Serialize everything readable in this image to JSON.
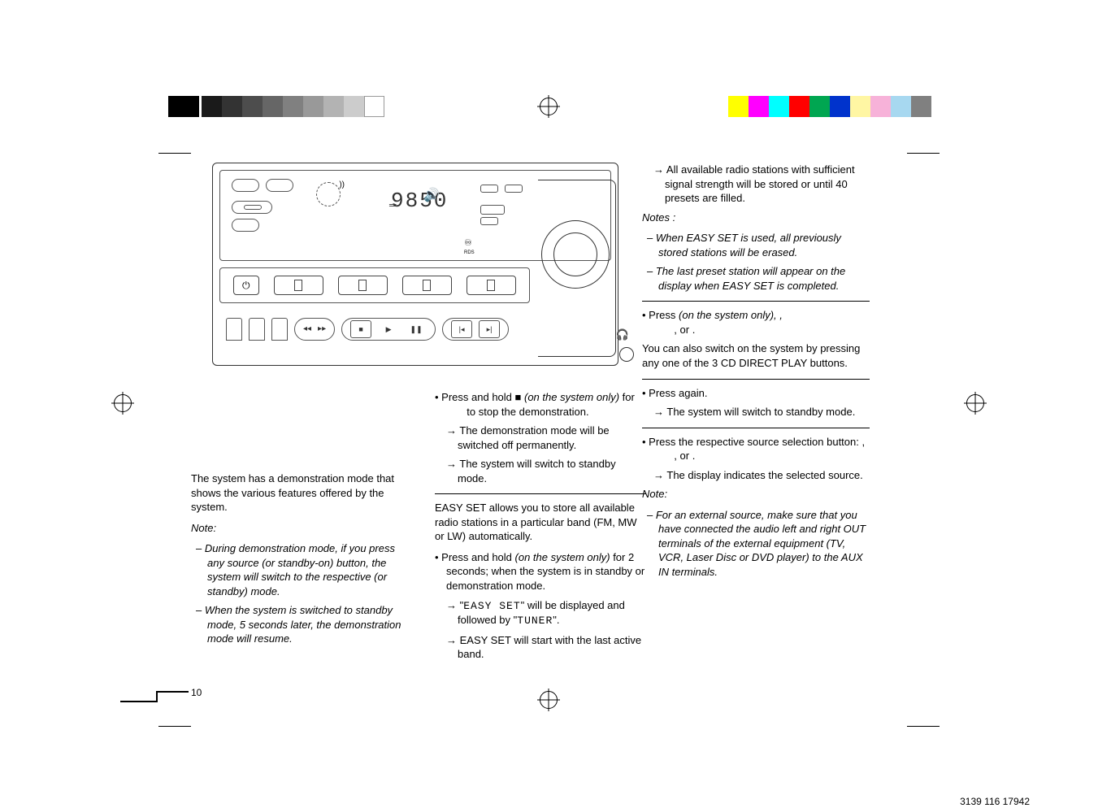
{
  "device": {
    "display": "9850"
  },
  "col1": {
    "p1": "The system has a demonstration mode that shows the various features offered by the system.",
    "noteLabel": "Note:",
    "n1": "During demonstration mode, if you press any source (or standby-on) button, the system will switch to the respective (or standby) mode.",
    "n2": "When the system is switched to standby mode, 5 seconds later, the demonstration mode will resume."
  },
  "col2": {
    "b1a": "Press and hold ",
    "b1b": " (on the system only) ",
    "b1c": "for",
    "b1d": "to stop the demonstration.",
    "s1": "The demonstration mode will be switched off permanently.",
    "s2": "The system will switch to standby mode.",
    "p1": "EASY SET allows you to store all available radio stations in a particular band (FM, MW or LW) automatically.",
    "b2a": "Press and hold ",
    "b2b": "(on the system only)",
    "b2c": "for 2 seconds; when the system is in standby or demonstration mode.",
    "s3a": "\"",
    "s3b": "EASY SET",
    "s3c": "\" will be displayed and followed by \"",
    "s3d": "TUNER",
    "s3e": "\".",
    "s4": "EASY SET will start with the last active band."
  },
  "col3": {
    "s0": "All available radio stations with sufficient signal strength will be stored or until 40 presets are filled.",
    "notesLabel": "Notes :",
    "n1": "When EASY SET is used, all previously stored stations will be erased.",
    "n2": "The last preset station will appear on the display when EASY SET is completed.",
    "b1a": "Press ",
    "b1b": "(on the system only),   ,",
    "b1c": ",           or        .",
    "p1": "You can also switch on the system by pressing any one of the 3 CD DIRECT PLAY buttons.",
    "b2a": "Press ",
    "b2b": "again.",
    "s2": "The system will switch to standby mode.",
    "b3a": "Press the respective source selection button:      ,",
    "b3b": ",             or        .",
    "s3": "The display indicates the selected source.",
    "noteLabel2": "Note:",
    "n3": "For an external source, make sure that you have connected the audio left and right OUT terminals of the external equipment (TV, VCR, Laser Disc or DVD player) to the AUX IN terminals."
  },
  "footer": {
    "pageNum": "10",
    "docCode": "3139 116 17942"
  }
}
